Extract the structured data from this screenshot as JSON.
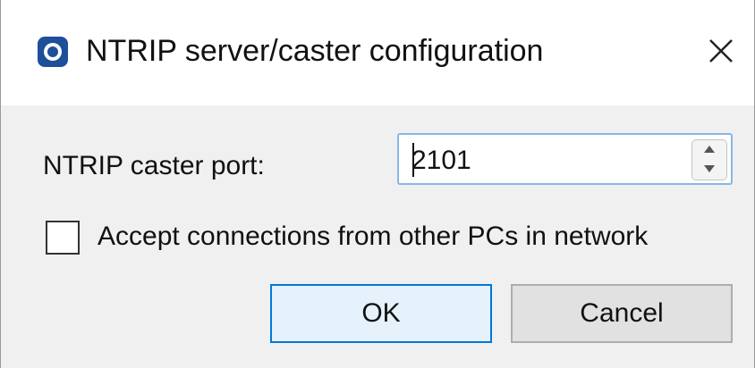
{
  "window": {
    "title": "NTRIP server/caster configuration",
    "icon": "app-ring-icon",
    "close_icon": "close-icon"
  },
  "form": {
    "port_label": "NTRIP caster port:",
    "port_value": "2101",
    "accept_label": "Accept connections from other PCs in network",
    "accept_checked": false
  },
  "buttons": {
    "ok_label": "OK",
    "cancel_label": "Cancel"
  },
  "colors": {
    "focus_border": "#86b8e6",
    "ok_border": "#0078d7",
    "ok_fill": "#e5f1fb",
    "dialog_bg": "#f0f0f0"
  }
}
